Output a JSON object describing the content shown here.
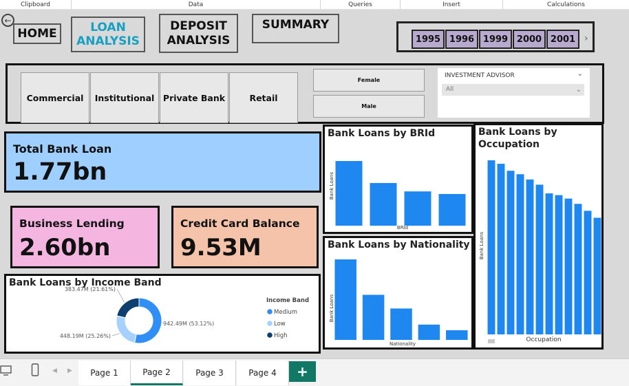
{
  "ribbon": {
    "groups": [
      "Clipboard",
      "Data",
      "Queries",
      "Insert",
      "Calculations"
    ]
  },
  "nav": {
    "home": "HOME",
    "loan_analysis": "LOAN ANALYSIS",
    "deposit_analysis": "DEPOSIT ANALYSIS",
    "summary": "SUMMARY"
  },
  "years": [
    "1995",
    "1996",
    "1999",
    "2000",
    "2001"
  ],
  "segments": [
    "Commercial",
    "Institutional",
    "Private Bank",
    "Retail"
  ],
  "gender": [
    "Female",
    "Male"
  ],
  "advisor": {
    "label": "INVESTMENT ADVISOR",
    "value": "All"
  },
  "kpis": {
    "total_loan": {
      "title": "Total Bank Loan",
      "value": "1.77bn",
      "color": "#9fcfff"
    },
    "business": {
      "title": "Business Lending",
      "value": "2.60bn",
      "color": "#f4b6e1"
    },
    "credit": {
      "title": "Credit Card Balance",
      "value": "9.53M",
      "color": "#f4c3aa"
    }
  },
  "accent": "#1e88f0",
  "chart_data": [
    {
      "type": "pie",
      "title": "Bank Loans by Income Band",
      "legend_title": "Income Band",
      "categories": [
        "Medium",
        "Low",
        "High"
      ],
      "values": [
        942.49,
        448.19,
        383.47
      ],
      "labels": [
        "942.49M (53.12%)",
        "448.19M (25.26%)",
        "383.47M (21.61%)"
      ],
      "colors": [
        "#2f8ff5",
        "#a6d1ff",
        "#0d3e70"
      ],
      "legend": "right"
    },
    {
      "type": "bar",
      "title": "Bank Loans by BRId",
      "xlabel": "BRId",
      "ylabel": "Bank Loans",
      "values": [
        100,
        66,
        53,
        49
      ]
    },
    {
      "type": "bar",
      "title": "Bank Loans by Nationality",
      "xlabel": "Nationality",
      "ylabel": "Bank Loans",
      "values": [
        100,
        56,
        39,
        19,
        12
      ]
    },
    {
      "type": "bar",
      "title": "Bank Loans by Occupation",
      "xlabel": "Occupation",
      "ylabel": "Bank Loans",
      "values": [
        100,
        98,
        94,
        92,
        89,
        86,
        81,
        80,
        78,
        75,
        71,
        67
      ]
    }
  ],
  "page_tabs": [
    "Page 1",
    "Page 2",
    "Page 3",
    "Page 4"
  ],
  "active_tab": "Page 2"
}
